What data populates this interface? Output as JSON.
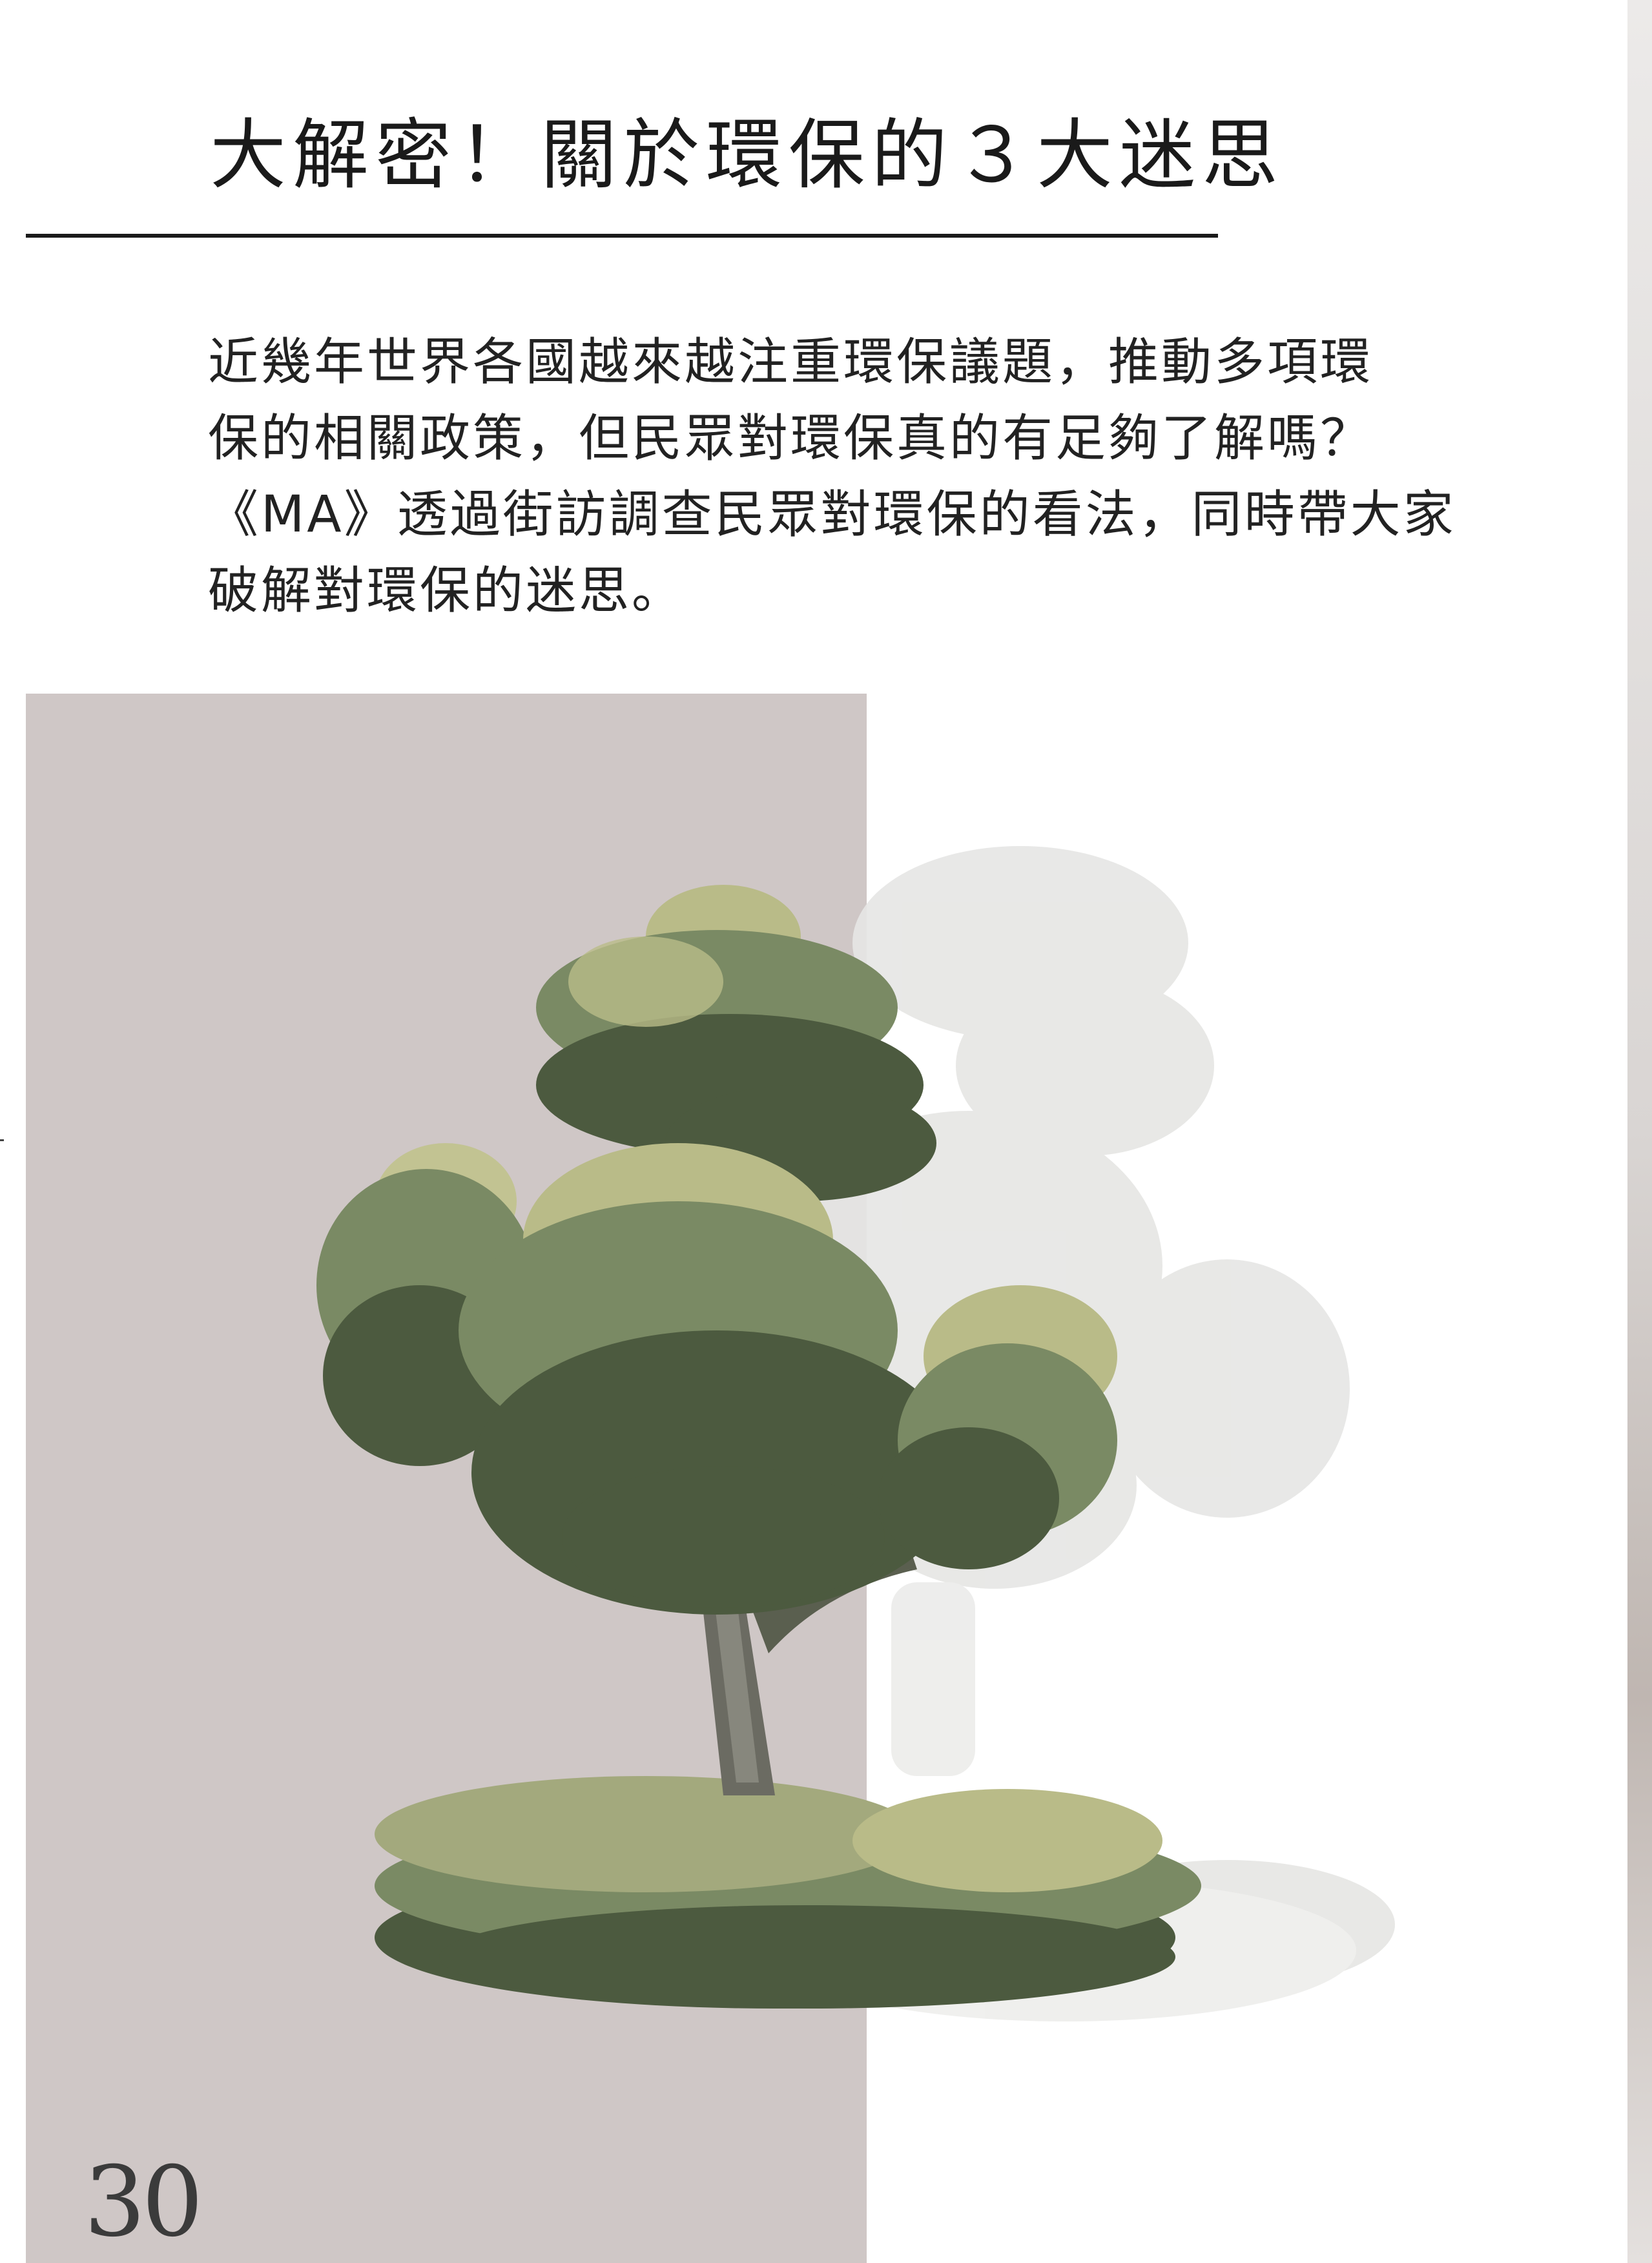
{
  "page": {
    "title": "大解密！關於環保的３大迷思",
    "intro_lines": [
      "近幾年世界各國越來越注重環保議題，推動多項環",
      "保的相關政策，但民眾對環保真的有足夠了解嗎？",
      "《MA》透過街訪調查民眾對環保的看法，同時帶大家",
      "破解對環保的迷思。"
    ],
    "page_number": "30"
  },
  "colors": {
    "panel": "#cfc7c6",
    "foliage_dark": "#4c5a3f",
    "foliage_mid": "#7a8a64",
    "foliage_light": "#b9bb88",
    "trunk": "#6b6b62",
    "ghost": "#e3e3e1"
  },
  "illustration": {
    "icon": "watercolor-tree-illustration"
  }
}
